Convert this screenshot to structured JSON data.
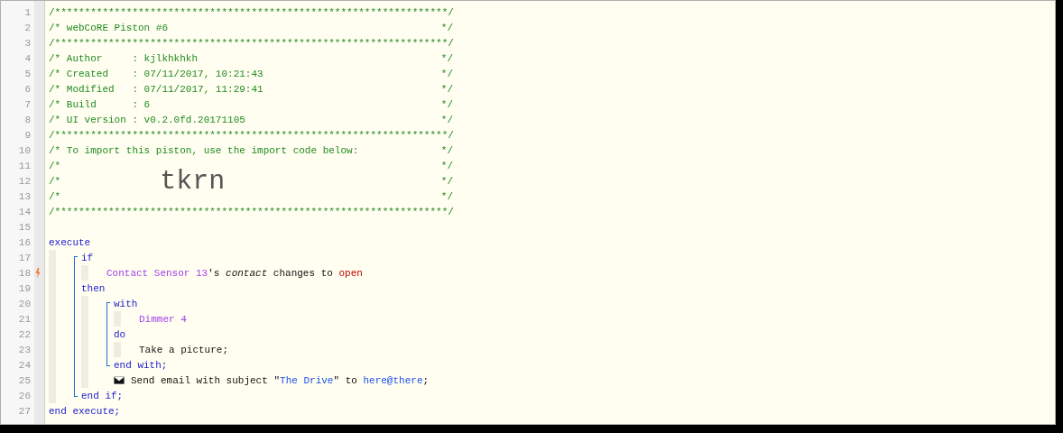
{
  "editor": {
    "lines": [
      {
        "kind": "rule",
        "number": "1",
        "text": "/******************************************************************/"
      },
      {
        "kind": "comment",
        "number": "2",
        "text": "/* webCoRE Piston #6",
        "end": "*/"
      },
      {
        "kind": "rule",
        "number": "3",
        "text": "/******************************************************************/"
      },
      {
        "kind": "comment",
        "number": "4",
        "text": "/* Author     : kjlkhkhkh",
        "end": "*/"
      },
      {
        "kind": "comment",
        "number": "5",
        "text": "/* Created    : 07/11/2017, 10:21:43",
        "end": "*/"
      },
      {
        "kind": "comment",
        "number": "6",
        "text": "/* Modified   : 07/11/2017, 11:29:41",
        "end": "*/"
      },
      {
        "kind": "comment",
        "number": "7",
        "text": "/* Build      : 6",
        "end": "*/"
      },
      {
        "kind": "comment",
        "number": "8",
        "text": "/* UI version : v0.2.0fd.20171105",
        "end": "*/"
      },
      {
        "kind": "rule",
        "number": "9",
        "text": "/******************************************************************/"
      },
      {
        "kind": "comment",
        "number": "10",
        "text": "/* To import this piston, use the import code below:",
        "end": "*/"
      },
      {
        "kind": "comment",
        "number": "11",
        "text": "/*",
        "end": "*/"
      },
      {
        "kind": "comment",
        "number": "12",
        "text": "/*",
        "big": "tkrn",
        "end": "*/"
      },
      {
        "kind": "comment",
        "number": "13",
        "text": "/*",
        "end": "*/"
      },
      {
        "kind": "rule",
        "number": "14",
        "text": "/******************************************************************/"
      },
      {
        "kind": "blank",
        "number": "15"
      },
      {
        "kind": "execute",
        "sections": [
          {
            "header": {
              "number": "16",
              "segments": [
                {
                  "kind": "keyword",
                  "text": "execute"
                }
              ]
            },
            "children": [
              {
                "kind": "block",
                "sections": [
                  {
                    "header": {
                      "number": "17",
                      "segments": [
                        {
                          "kind": "keyword",
                          "text": "if"
                        }
                      ]
                    },
                    "children": [
                      {
                        "kind": "leaf",
                        "number": "18",
                        "trigger": true,
                        "segments": [
                          {
                            "kind": "device",
                            "text": "Contact Sensor 13"
                          },
                          {
                            "kind": "text",
                            "text": "'s "
                          },
                          {
                            "kind": "attribute",
                            "text": "contact"
                          },
                          {
                            "kind": "text",
                            "text": " changes to "
                          },
                          {
                            "kind": "value",
                            "text": "open"
                          }
                        ]
                      }
                    ]
                  },
                  {
                    "header": {
                      "number": "19",
                      "segments": [
                        {
                          "kind": "keyword",
                          "text": "then"
                        }
                      ]
                    },
                    "children": [
                      {
                        "kind": "block",
                        "sections": [
                          {
                            "header": {
                              "number": "20",
                              "segments": [
                                {
                                  "kind": "keyword",
                                  "text": "with"
                                }
                              ]
                            },
                            "children": [
                              {
                                "kind": "leaf",
                                "number": "21",
                                "trigger": false,
                                "segments": [
                                  {
                                    "kind": "device",
                                    "text": "Dimmer 4"
                                  }
                                ]
                              }
                            ]
                          },
                          {
                            "header": {
                              "number": "22",
                              "segments": [
                                {
                                  "kind": "keyword",
                                  "text": "do"
                                }
                              ]
                            },
                            "children": [
                              {
                                "kind": "leaf",
                                "number": "23",
                                "trigger": false,
                                "segments": [
                                  {
                                    "kind": "text",
                                    "text": "Take a picture;"
                                  }
                                ]
                              }
                            ]
                          }
                        ],
                        "footer": {
                          "number": "24",
                          "segments": [
                            {
                              "kind": "keyword",
                              "text": "end with;"
                            }
                          ]
                        }
                      },
                      {
                        "kind": "email",
                        "number": "25",
                        "trigger": false,
                        "segments": [
                          {
                            "kind": "text",
                            "text": "Send email with subject \""
                          },
                          {
                            "kind": "string",
                            "text": "The Drive"
                          },
                          {
                            "kind": "text",
                            "text": "\" to "
                          },
                          {
                            "kind": "string",
                            "text": "here@there"
                          },
                          {
                            "kind": "text",
                            "text": ";"
                          }
                        ]
                      }
                    ]
                  }
                ],
                "footer": {
                  "number": "26",
                  "segments": [
                    {
                      "kind": "keyword",
                      "text": "end if;"
                    }
                  ]
                }
              }
            ]
          }
        ],
        "footer": {
          "number": "27",
          "segments": [
            {
              "kind": "keyword",
              "text": "end execute;"
            }
          ]
        }
      }
    ]
  }
}
